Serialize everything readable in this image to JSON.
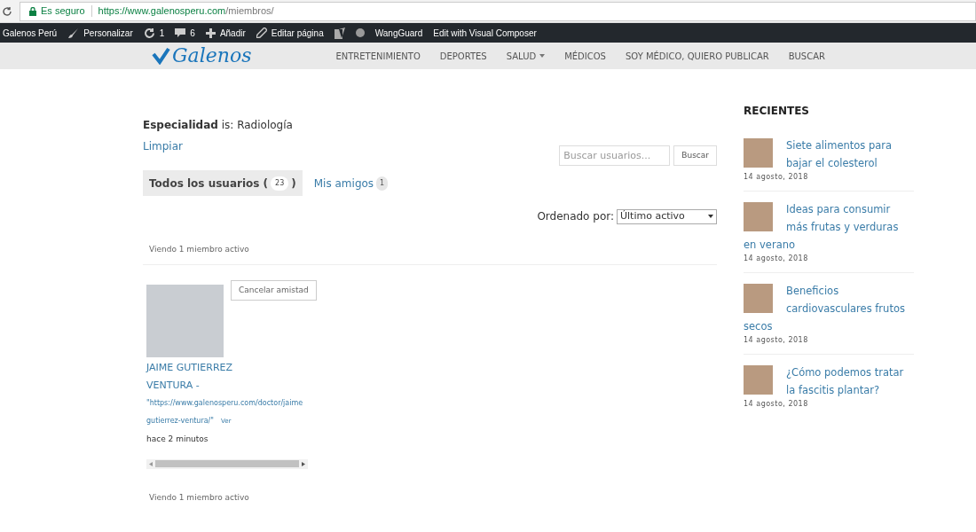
{
  "browser": {
    "security": "Es seguro",
    "url_host": "https://www.galenosperu.com",
    "url_path": "/miembros/"
  },
  "admin_bar": [
    {
      "kind": "text",
      "label": "Galenos Perú"
    },
    {
      "kind": "brush",
      "label": "Personalizar"
    },
    {
      "kind": "updates",
      "label": "1"
    },
    {
      "kind": "comments",
      "label": "6"
    },
    {
      "kind": "plus",
      "label": "Añadir"
    },
    {
      "kind": "pencil",
      "label": "Editar página"
    },
    {
      "kind": "seo"
    },
    {
      "kind": "dot"
    },
    {
      "kind": "text",
      "label": "WangGuard"
    },
    {
      "kind": "text",
      "label": "Edit with Visual Composer"
    }
  ],
  "header": {
    "logo": "Galenos",
    "nav": [
      {
        "label": "ENTRETENIMIENTO",
        "has_caret": false
      },
      {
        "label": "DEPORTES",
        "has_caret": false
      },
      {
        "label": "SALUD",
        "has_caret": true
      },
      {
        "label": "MÉDICOS",
        "has_caret": false
      },
      {
        "label": "SOY MÉDICO, QUIERO PUBLICAR",
        "has_caret": false
      },
      {
        "label": "BUSCAR",
        "has_caret": false
      }
    ]
  },
  "filter": {
    "text": "**Especialidad** is: Radiología",
    "clear": "Limpiar"
  },
  "search": {
    "placeholder": "Buscar usuarios...",
    "button": "Buscar"
  },
  "tabs": [
    {
      "label": "Todos los usuarios (",
      "count": "23",
      "suffix": ")",
      "selected": true
    },
    {
      "label": "Mis amigos",
      "count": "1",
      "selected": false
    }
  ],
  "order": {
    "label": "Ordenado por:",
    "value": "Último activo"
  },
  "pagination_top": "Viendo 1 miembro activo",
  "members": [
    {
      "name": "JAIME GUTIERREZ VENTURA -",
      "link_lines": [
        "\"https://www.galenosperu.com/doctor/jaime",
        "gutierrez-ventura/\""
      ],
      "view": "Ver",
      "activity": "hace 2 minutos",
      "action": "Cancelar amistad"
    }
  ],
  "pagination_bottom": "Viendo 1 miembro activo",
  "sidebar": {
    "title": "RECIENTES",
    "posts": [
      {
        "title": "Siete alimentos para bajar el colesterol",
        "date": "14 agosto, 2018"
      },
      {
        "title": "Ideas para consumir más frutas y verduras en verano",
        "date": "14 agosto, 2018"
      },
      {
        "title": "Beneficios cardiovasculares frutos secos",
        "date": "14 agosto, 2018"
      },
      {
        "title": "¿Cómo podemos tratar la fascitis plantar?",
        "date": "14 agosto, 2018"
      }
    ]
  }
}
